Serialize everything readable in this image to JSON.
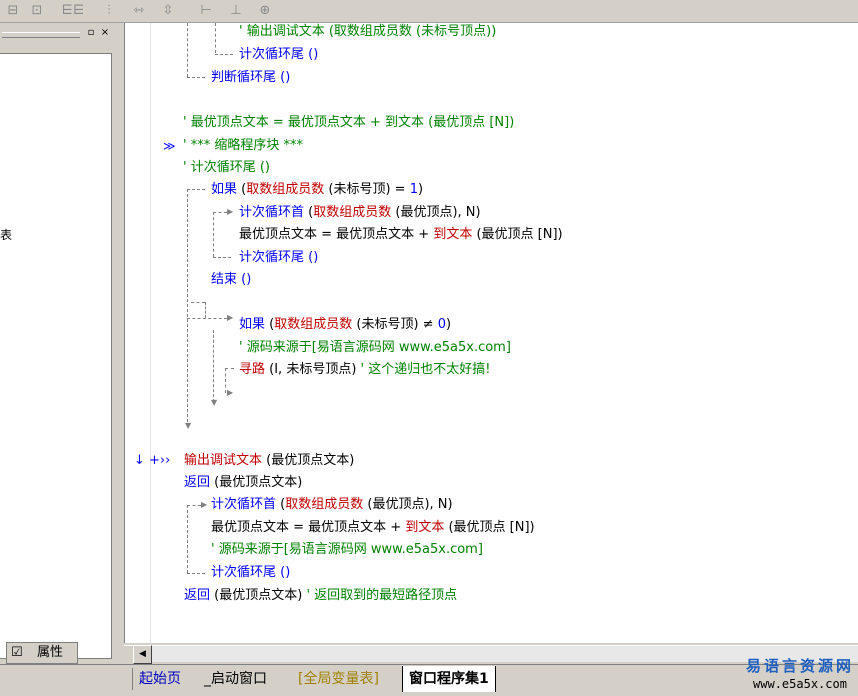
{
  "toolbar": {
    "icons": [
      "align-left-icon",
      "align-center-icon",
      "align-top-icon",
      "align-middle-icon",
      "equal-width-icon",
      "equal-height-icon",
      "h-space-icon",
      "v-space-icon",
      "center-icon"
    ]
  },
  "left_panel": {
    "cut_text": "表",
    "pin_glyph": "▫",
    "close_glyph": "×",
    "properties_tab": "属性"
  },
  "code": {
    "l1_prefix": "'",
    "l1": "输出调试文本 (取数组成员数 (未标号顶点))",
    "l2": "计次循环尾 ()",
    "l3": "判断循环尾 ()",
    "l4": "' 最优顶点文本 = 最优顶点文本 + 到文本 (最优顶点 [N])",
    "l5_marker": "≫",
    "l5": "' *** 缩略程序块 ***",
    "l6": "' 计次循环尾 ()",
    "l7_kw": "如果",
    "l7_a": " (",
    "l7_fn": "取数组成员数",
    "l7_b": " (未标号顶) = ",
    "l7_num": "1",
    "l7_c": ")",
    "l8_kw": "计次循环首",
    "l8_a": " (",
    "l8_fn": "取数组成员数",
    "l8_b": " (最优顶点), N)",
    "l9_a": "最优顶点文本 = 最优顶点文本 + ",
    "l9_fn": "到文本",
    "l9_b": " (最优顶点 [N])",
    "l10": "计次循环尾 ()",
    "l11": "结束 ()",
    "l12_kw": "如果",
    "l12_a": " (",
    "l12_fn": "取数组成员数",
    "l12_b": " (未标号顶) ≠ ",
    "l12_num": "0",
    "l12_c": ")",
    "l13": "' 源码来源于[易语言源码网 www.e5a5x.com]",
    "l14_fn": "寻路",
    "l14_a": " (I, 未标号顶点) ",
    "l14_cm": "' 这个递归也不太好搞!",
    "l15_marks": "↓ +››",
    "l15_fn": "输出调试文本",
    "l15_a": " (最优顶点文本)",
    "l16_kw": "返回",
    "l16_a": " (最优顶点文本)",
    "l17_kw": "计次循环首",
    "l17_a": " (",
    "l17_fn": "取数组成员数",
    "l17_b": " (最优顶点), N)",
    "l18_a": "最优顶点文本 = 最优顶点文本 + ",
    "l18_fn": "到文本",
    "l18_b": " (最优顶点 [N])",
    "l19": "' 源码来源于[易语言源码网 www.e5a5x.com]",
    "l20": "计次循环尾 ()",
    "l21_kw": "返回",
    "l21_a": " (最优顶点文本) ",
    "l21_cm": "' 返回取到的最短路径顶点"
  },
  "scroll": {
    "left_arrow": "◀"
  },
  "tabs": [
    {
      "label": "起始页",
      "color": "#0000c0"
    },
    {
      "label": "_启动窗口",
      "color": "#000000"
    },
    {
      "label": "[全局变量表]",
      "color": "#a08000"
    },
    {
      "label": "窗口程序集1",
      "color": "#000000"
    }
  ],
  "brand": {
    "cn": "易语言资源网",
    "url": "www.e5a5x.com",
    "cn_color": "#1f5fbf"
  }
}
